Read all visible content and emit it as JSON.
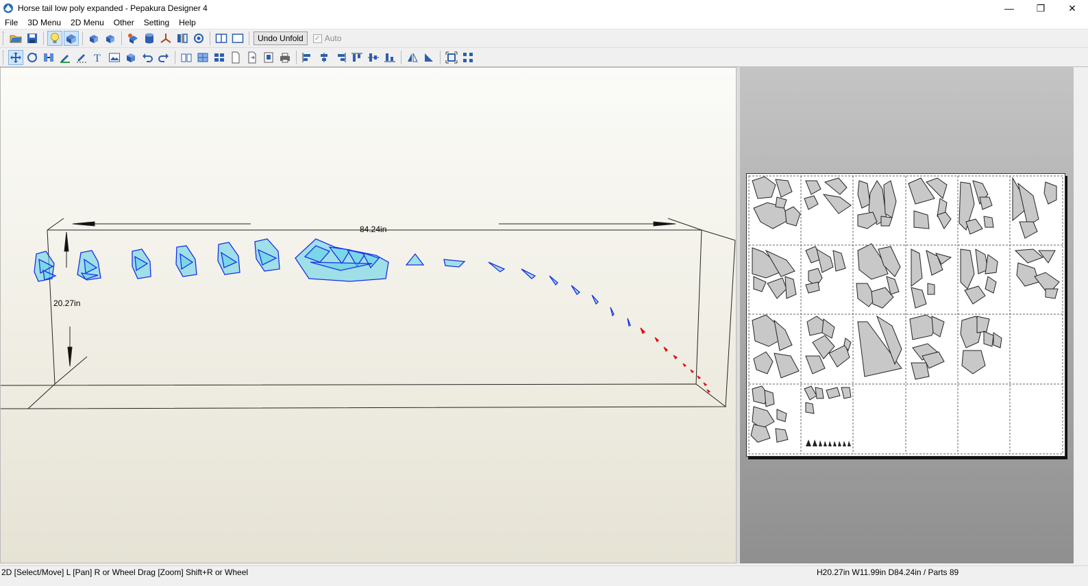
{
  "window": {
    "title": "Horse tail low poly expanded - Pepakura Designer 4",
    "controls": [
      "—",
      "❐",
      "✕"
    ]
  },
  "menu": [
    "File",
    "3D Menu",
    "2D Menu",
    "Other",
    "Setting",
    "Help"
  ],
  "toolbar1": {
    "icons": [
      "open-icon",
      "save-icon",
      "light-icon",
      "texture-icon",
      "rotate-model-icon",
      "rotate-model-alt-icon",
      "object-icon",
      "cylinder-icon",
      "axis-icon",
      "mirror-icon",
      "view-icon",
      "split-view-icon",
      "single-view-icon"
    ],
    "undo_unfold_label": "Undo Unfold",
    "auto_label": "Auto"
  },
  "toolbar2": {
    "icons": [
      "select-move-icon",
      "rotate-part-icon",
      "join-icon",
      "pen-icon",
      "crease-icon",
      "text-icon",
      "image-icon",
      "box-icon",
      "undo-icon",
      "redo-icon",
      "book-icon",
      "grid-icon",
      "layout-icon",
      "page-icon",
      "page-next-icon",
      "page-setup-icon",
      "print-icon",
      "align-left-icon",
      "align-center-icon",
      "align-right-icon",
      "align-top-icon",
      "align-middle-icon",
      "align-bottom-icon",
      "flip-icon",
      "flip-alt-icon",
      "fit-icon",
      "distribute-icon"
    ]
  },
  "view3d": {
    "width_label": "84.24in",
    "height_label": "20.27in"
  },
  "status": {
    "left": "2D [Select/Move] L [Pan] R or Wheel Drag [Zoom] Shift+R or Wheel",
    "right": "H20.27in W11.99in D84.24in / Parts 89"
  },
  "colors": {
    "model_blue": "#1a2ee6",
    "model_cyan": "#5ad0e8",
    "model_red": "#e01010",
    "part_fill": "#c8c8c8"
  }
}
